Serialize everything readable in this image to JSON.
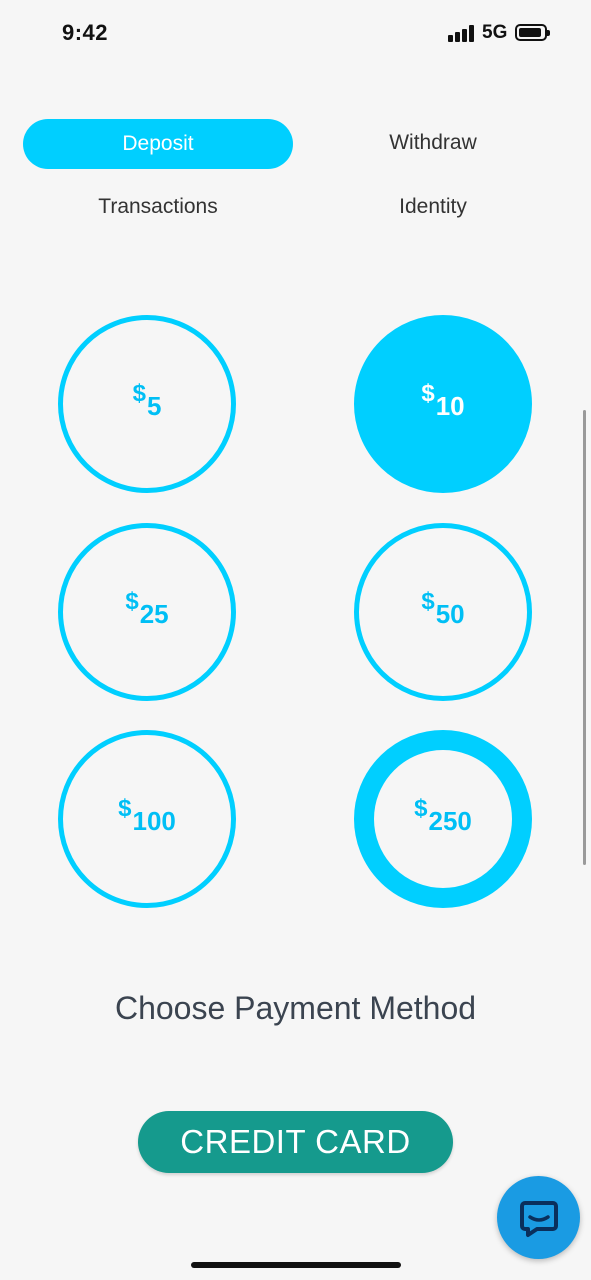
{
  "status_bar": {
    "time": "9:42",
    "network": "5G",
    "signal_icon": "cellular-signal-icon",
    "battery_icon": "battery-icon"
  },
  "tabs": [
    {
      "label": "Deposit",
      "active": true
    },
    {
      "label": "Withdraw",
      "active": false
    },
    {
      "label": "Transactions",
      "active": false
    },
    {
      "label": "Identity",
      "active": false
    }
  ],
  "amounts": [
    {
      "currency": "$",
      "value": "5",
      "state": "default"
    },
    {
      "currency": "$",
      "value": "10",
      "state": "selected"
    },
    {
      "currency": "$",
      "value": "25",
      "state": "default"
    },
    {
      "currency": "$",
      "value": "50",
      "state": "default"
    },
    {
      "currency": "$",
      "value": "100",
      "state": "default"
    },
    {
      "currency": "$",
      "value": "250",
      "state": "highlighted"
    }
  ],
  "payment": {
    "heading": "Choose Payment Method",
    "credit_card_label": "CREDIT CARD"
  },
  "chat": {
    "icon": "chat-bubble-icon"
  },
  "colors": {
    "accent": "#00cfff",
    "button": "#159a8d",
    "chat_fab": "#1a9be3"
  }
}
